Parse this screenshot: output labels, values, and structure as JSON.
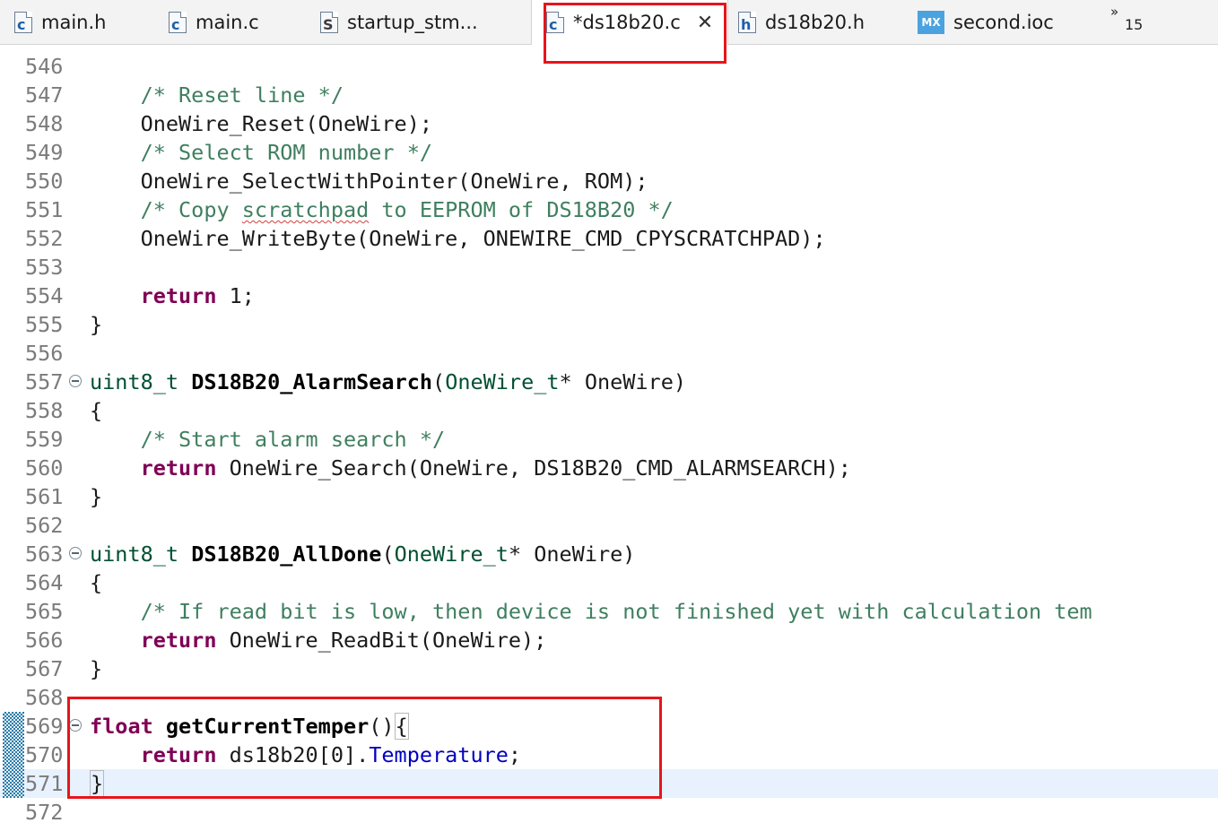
{
  "tabs": [
    {
      "label": "main.h",
      "icon": "h-file-icon",
      "glyph": "c",
      "active": false
    },
    {
      "label": "main.c",
      "icon": "c-file-icon",
      "glyph": "c",
      "active": false
    },
    {
      "label": "startup_stm...",
      "icon": "s-file-icon",
      "glyph": "S",
      "active": false
    },
    {
      "label": "*ds18b20.c",
      "icon": "c-file-icon",
      "glyph": "c",
      "active": true
    },
    {
      "label": "ds18b20.h",
      "icon": "h-file-icon",
      "glyph": "h",
      "active": false
    },
    {
      "label": "second.ioc",
      "icon": "mx-icon",
      "glyph": "MX",
      "active": false
    }
  ],
  "overflow": {
    "chevron": "»",
    "count": "15"
  },
  "close_glyph": "✕",
  "lines": [
    {
      "num": "546",
      "tokens": []
    },
    {
      "num": "547",
      "tokens": [
        {
          "t": "    "
        },
        {
          "t": "/* Reset line */",
          "c": "cm"
        }
      ]
    },
    {
      "num": "548",
      "tokens": [
        {
          "t": "    OneWire_Reset(OneWire);"
        }
      ]
    },
    {
      "num": "549",
      "tokens": [
        {
          "t": "    "
        },
        {
          "t": "/* Select ROM number */",
          "c": "cm"
        }
      ]
    },
    {
      "num": "550",
      "tokens": [
        {
          "t": "    OneWire_SelectWithPointer(OneWire, ROM);"
        }
      ]
    },
    {
      "num": "551",
      "tokens": [
        {
          "t": "    "
        },
        {
          "t": "/* Copy ",
          "c": "cm"
        },
        {
          "t": "scratchpad",
          "c": "cm sq"
        },
        {
          "t": " to EEPROM of DS18B20 */",
          "c": "cm"
        }
      ]
    },
    {
      "num": "552",
      "tokens": [
        {
          "t": "    OneWire_WriteByte(OneWire, ONEWIRE_CMD_CPYSCRATCHPAD);"
        }
      ]
    },
    {
      "num": "553",
      "tokens": []
    },
    {
      "num": "554",
      "tokens": [
        {
          "t": "    "
        },
        {
          "t": "return",
          "c": "kw"
        },
        {
          "t": " 1;"
        }
      ]
    },
    {
      "num": "555",
      "tokens": [
        {
          "t": "}"
        }
      ]
    },
    {
      "num": "556",
      "tokens": []
    },
    {
      "num": "557",
      "fold": true,
      "tokens": [
        {
          "t": "uint8_t",
          "c": "ty"
        },
        {
          "t": " "
        },
        {
          "t": "DS18B20_AlarmSearch",
          "c": "fn"
        },
        {
          "t": "("
        },
        {
          "t": "OneWire_t",
          "c": "ty"
        },
        {
          "t": "* OneWire)"
        }
      ]
    },
    {
      "num": "558",
      "tokens": [
        {
          "t": "{"
        }
      ]
    },
    {
      "num": "559",
      "tokens": [
        {
          "t": "    "
        },
        {
          "t": "/* Start alarm search */",
          "c": "cm"
        }
      ]
    },
    {
      "num": "560",
      "tokens": [
        {
          "t": "    "
        },
        {
          "t": "return",
          "c": "kw"
        },
        {
          "t": " OneWire_Search(OneWire, DS18B20_CMD_ALARMSEARCH);"
        }
      ]
    },
    {
      "num": "561",
      "tokens": [
        {
          "t": "}"
        }
      ]
    },
    {
      "num": "562",
      "tokens": []
    },
    {
      "num": "563",
      "fold": true,
      "tokens": [
        {
          "t": "uint8_t",
          "c": "ty"
        },
        {
          "t": " "
        },
        {
          "t": "DS18B20_AllDone",
          "c": "fn"
        },
        {
          "t": "("
        },
        {
          "t": "OneWire_t",
          "c": "ty"
        },
        {
          "t": "* OneWire)"
        }
      ]
    },
    {
      "num": "564",
      "tokens": [
        {
          "t": "{"
        }
      ]
    },
    {
      "num": "565",
      "tokens": [
        {
          "t": "    "
        },
        {
          "t": "/* If read bit is low, then device is not finished yet with calculation tem",
          "c": "cm"
        }
      ]
    },
    {
      "num": "566",
      "tokens": [
        {
          "t": "    "
        },
        {
          "t": "return",
          "c": "kw"
        },
        {
          "t": " OneWire_ReadBit(OneWire);"
        }
      ]
    },
    {
      "num": "567",
      "tokens": [
        {
          "t": "}"
        }
      ]
    },
    {
      "num": "568",
      "tokens": []
    },
    {
      "num": "569",
      "fold": true,
      "changed": true,
      "tokens": [
        {
          "t": "float",
          "c": "kw"
        },
        {
          "t": " "
        },
        {
          "t": "getCurrentTemper",
          "c": "fn"
        },
        {
          "t": "()"
        },
        {
          "t": "{",
          "c": "bbox"
        }
      ]
    },
    {
      "num": "570",
      "changed": true,
      "tokens": [
        {
          "t": "    "
        },
        {
          "t": "return",
          "c": "kw"
        },
        {
          "t": " ds18b20[0]."
        },
        {
          "t": "Temperature",
          "c": "fld"
        },
        {
          "t": ";"
        }
      ]
    },
    {
      "num": "571",
      "changed": true,
      "current": true,
      "tokens": [
        {
          "t": "}",
          "c": "bbox"
        }
      ]
    },
    {
      "num": "572",
      "tokens": []
    }
  ],
  "highlight_color": "#e8141b"
}
